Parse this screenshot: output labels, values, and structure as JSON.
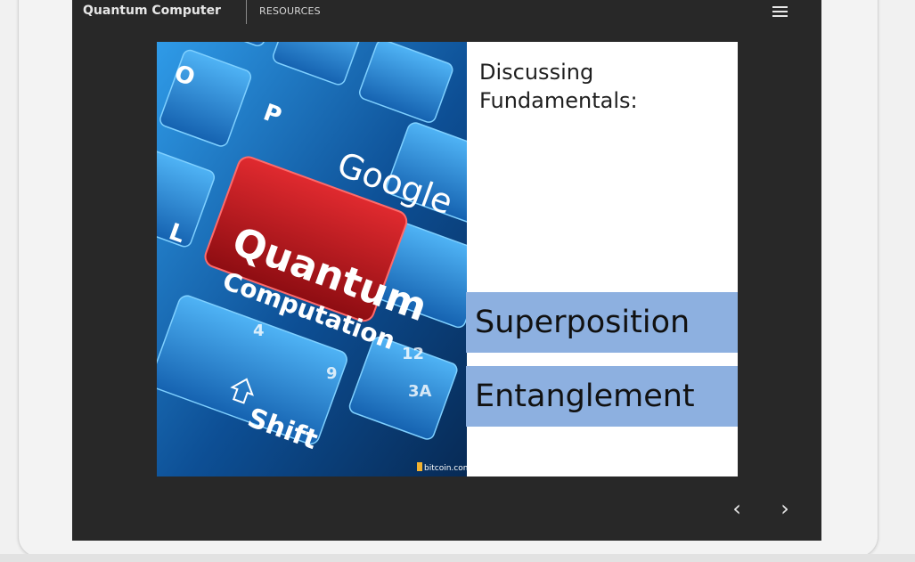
{
  "header": {
    "title": "Quantum Computer",
    "resources_label": "RESOURCES",
    "menu_icon": "hamburger-icon"
  },
  "slide": {
    "image": {
      "caption_line1": "Quantum",
      "caption_line2": "Computation",
      "keys": [
        "O",
        "P",
        "L",
        "Google",
        "Shift",
        "4",
        "9",
        "12",
        "3A"
      ],
      "credit": "bitcoin.com"
    },
    "heading_line1": "Discussing",
    "heading_line2": "Fundamentals:",
    "topics": [
      "Superposition",
      "Entanglement"
    ]
  },
  "navigation": {
    "prev_glyph": "‹",
    "next_glyph": "›"
  },
  "colors": {
    "player_bg": "#282828",
    "highlight": "#8db0e0",
    "key_blue": "#1f7fd0",
    "key_red": "#c8141c"
  }
}
